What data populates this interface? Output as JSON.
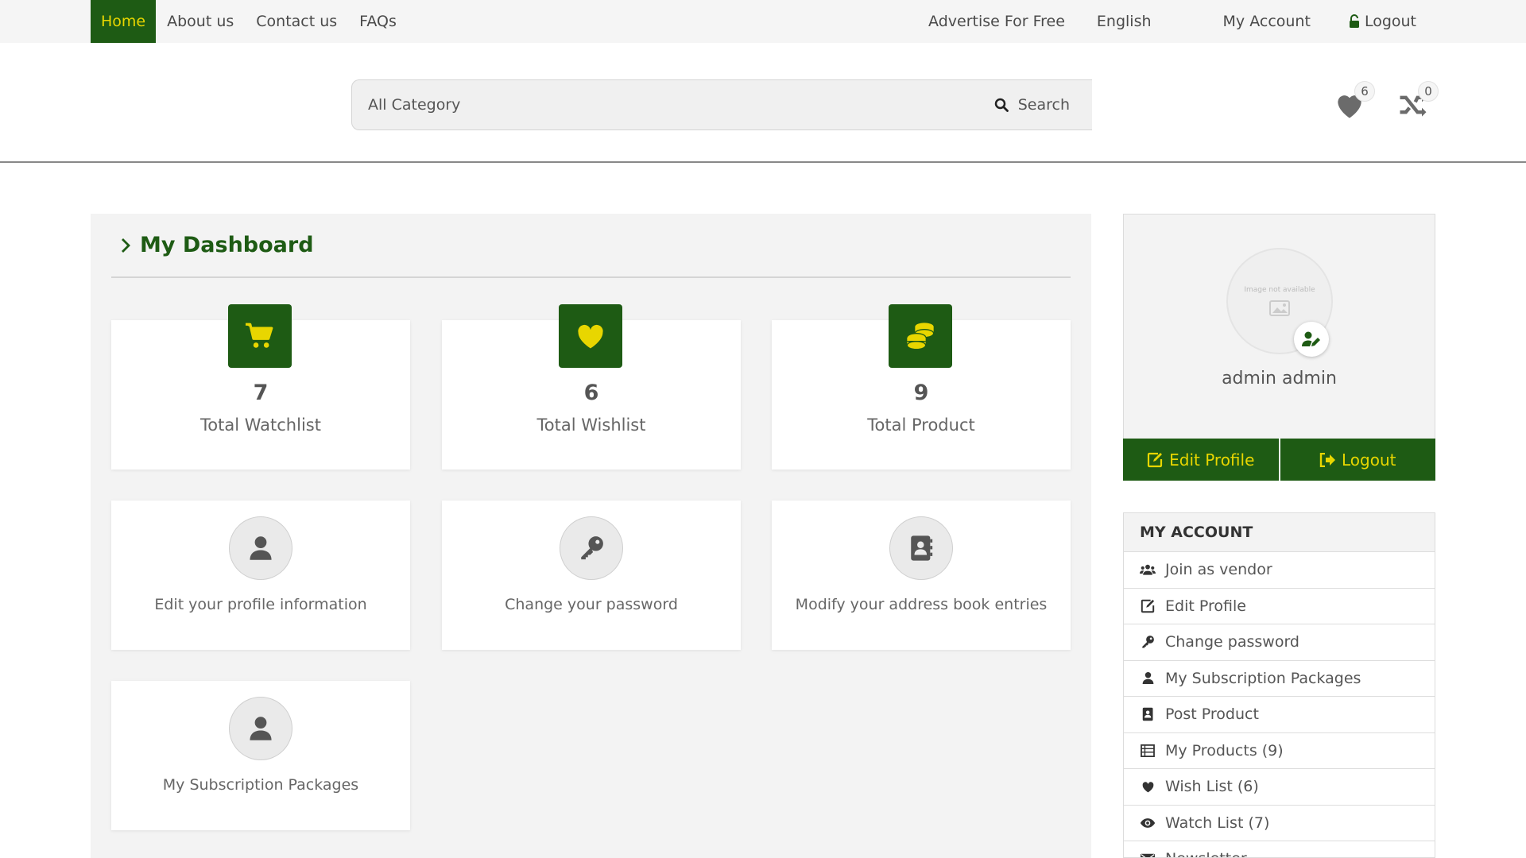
{
  "topnav": {
    "items": [
      {
        "label": "Home",
        "active": true
      },
      {
        "label": "About us"
      },
      {
        "label": "Contact us"
      },
      {
        "label": "FAQs"
      }
    ],
    "advertise": "Advertise For Free",
    "language": "English",
    "my_account": "My Account",
    "logout": "Logout"
  },
  "search": {
    "category": "All Category",
    "button": "Search"
  },
  "header_icons": {
    "wishlist_icon": "heart-icon",
    "wishlist_count": "6",
    "compare_icon": "shuffle-icon",
    "compare_count": "0"
  },
  "dashboard": {
    "title": "My Dashboard",
    "stats": [
      {
        "icon": "cart-icon",
        "value": "7",
        "label": "Total Watchlist"
      },
      {
        "icon": "heart-icon",
        "value": "6",
        "label": "Total Wishlist"
      },
      {
        "icon": "coins-icon",
        "value": "9",
        "label": "Total Product"
      }
    ],
    "links": [
      {
        "icon": "user-icon",
        "label": "Edit your profile information"
      },
      {
        "icon": "key-icon",
        "label": "Change your password"
      },
      {
        "icon": "address-book-icon",
        "label": "Modify your address book entries"
      },
      {
        "icon": "user-icon",
        "label": "My Subscription Packages"
      }
    ]
  },
  "profile": {
    "image_placeholder": "Image not available",
    "name": "admin admin",
    "edit_button": "Edit Profile",
    "logout_button": "Logout"
  },
  "account_menu": {
    "title": "MY ACCOUNT",
    "items": [
      {
        "icon": "users-icon",
        "label": "Join as vendor"
      },
      {
        "icon": "edit-icon",
        "label": "Edit Profile"
      },
      {
        "icon": "key-icon",
        "label": "Change password"
      },
      {
        "icon": "user-icon",
        "label": "My Subscription Packages"
      },
      {
        "icon": "address-book-icon",
        "label": "Post Product"
      },
      {
        "icon": "list-icon",
        "label": "My Products (9)"
      },
      {
        "icon": "heart-icon",
        "label": "Wish List (6)"
      },
      {
        "icon": "eye-icon",
        "label": "Watch List (7)"
      },
      {
        "icon": "envelope-icon",
        "label": "Newsletter"
      }
    ]
  },
  "colors": {
    "brand_green": "#1e5b14",
    "brand_yellow": "#e8d600"
  }
}
